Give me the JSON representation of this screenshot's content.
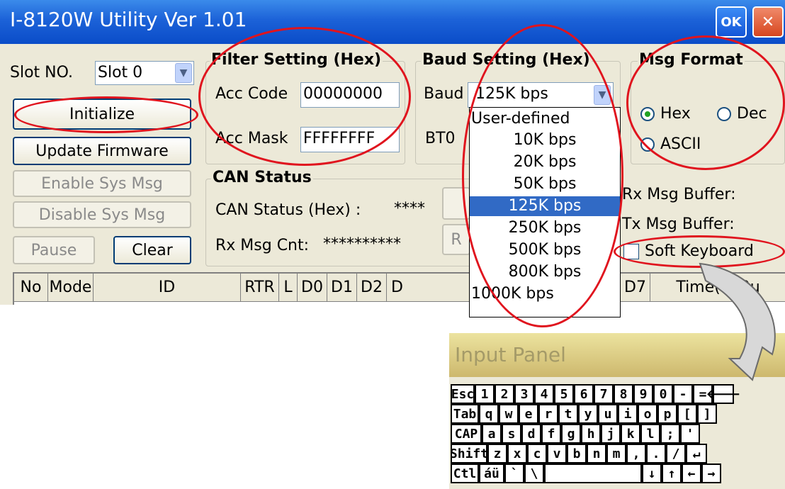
{
  "window": {
    "title": "I-8120W Utility Ver 1.01",
    "ok_label": "OK",
    "close_label": "✕"
  },
  "slot": {
    "label": "Slot NO.",
    "value": "Slot 0"
  },
  "buttons": {
    "initialize": "Initialize",
    "update_firmware": "Update Firmware",
    "enable_sys_msg": "Enable Sys Msg",
    "disable_sys_msg": "Disable Sys Msg",
    "pause": "Pause",
    "clear": "Clear"
  },
  "filter": {
    "title": "Filter Setting (Hex)",
    "acc_code_label": "Acc Code",
    "acc_code_value": "00000000",
    "acc_mask_label": "Acc Mask",
    "acc_mask_value": "FFFFFFFF"
  },
  "baud": {
    "title": "Baud Setting (Hex)",
    "baud_label": "Baud",
    "baud_value": "125K bps",
    "bt0_label": "BT0",
    "options": [
      "User-defined",
      "10K bps",
      "20K bps",
      "50K bps",
      "125K bps",
      "250K bps",
      "500K bps",
      "800K bps",
      "1000K bps"
    ],
    "selected_index": 4
  },
  "msg_format": {
    "title": "Msg Format",
    "hex": "Hex",
    "dec": "Dec",
    "ascii": "ASCII",
    "selected": "Hex"
  },
  "can_status": {
    "title": "CAN Status",
    "status_label": "CAN Status (Hex) :",
    "status_value": "****",
    "rx_cnt_label": "Rx Msg Cnt:",
    "rx_cnt_value": "**********",
    "r_button": "R"
  },
  "buffers": {
    "rx": "Rx Msg Buffer:",
    "tx": "Tx Msg Buffer:"
  },
  "soft_keyboard": {
    "label": "Soft Keyboard",
    "checked": false
  },
  "table": {
    "columns": [
      "No",
      "Mode",
      "ID",
      "RTR",
      "L",
      "D0",
      "D1",
      "D2",
      "D",
      "D7",
      "Time(100u"
    ]
  },
  "input_panel": {
    "title": "Input Panel",
    "rows": [
      [
        "Esc",
        "1",
        "2",
        "3",
        "4",
        "5",
        "6",
        "7",
        "8",
        "9",
        "0",
        "-",
        "=",
        "🡐"
      ],
      [
        "Tab",
        "q",
        "w",
        "e",
        "r",
        "t",
        "y",
        "u",
        "i",
        "o",
        "p",
        "[",
        "]"
      ],
      [
        "CAP",
        "a",
        "s",
        "d",
        "f",
        "g",
        "h",
        "j",
        "k",
        "l",
        ";",
        "'"
      ],
      [
        "Shift",
        "z",
        "x",
        "c",
        "v",
        "b",
        "n",
        "m",
        ",",
        ".",
        "/",
        "↵"
      ],
      [
        "Ctl",
        "áü",
        "`",
        "\\",
        "↓",
        "↑",
        "←",
        "→"
      ]
    ]
  },
  "colors": {
    "titlebar": "#0A4CC8",
    "window_bg": "#ECE9D8",
    "highlight": "#316AC5",
    "annotation": "#e0141e",
    "close_button": "#E45A34"
  }
}
